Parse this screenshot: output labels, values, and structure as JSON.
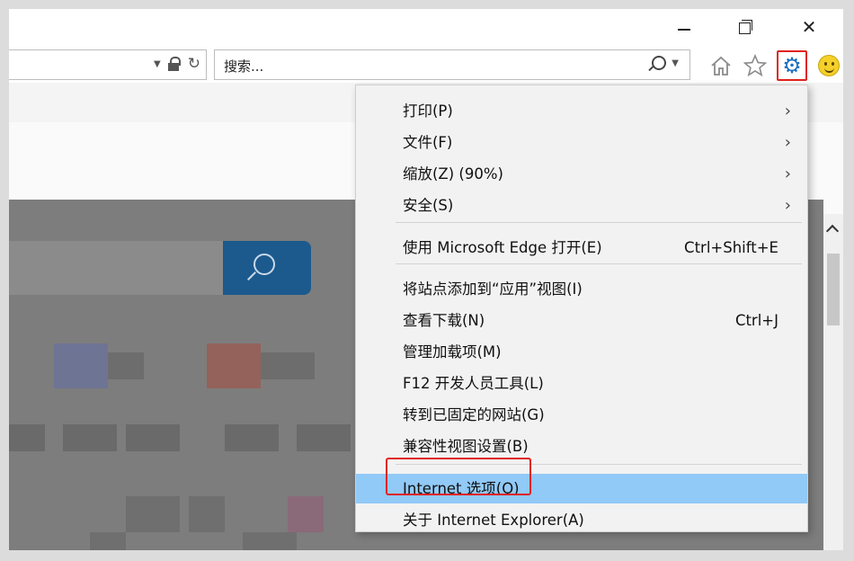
{
  "search": {
    "placeholder": "搜索..."
  },
  "menu": {
    "items": [
      {
        "label": "打印(P)",
        "shortcut": "",
        "submenu": true
      },
      {
        "label": "文件(F)",
        "shortcut": "",
        "submenu": true
      },
      {
        "label": "缩放(Z) (90%)",
        "shortcut": "",
        "submenu": true
      },
      {
        "label": "安全(S)",
        "shortcut": "",
        "submenu": true
      },
      {
        "label": "使用 Microsoft Edge 打开(E)",
        "shortcut": "Ctrl+Shift+E",
        "submenu": false
      },
      {
        "label": "将站点添加到“应用”视图(I)",
        "shortcut": "",
        "submenu": false
      },
      {
        "label": "查看下载(N)",
        "shortcut": "Ctrl+J",
        "submenu": false
      },
      {
        "label": "管理加载项(M)",
        "shortcut": "",
        "submenu": false
      },
      {
        "label": "F12 开发人员工具(L)",
        "shortcut": "",
        "submenu": false
      },
      {
        "label": "转到已固定的网站(G)",
        "shortcut": "",
        "submenu": false
      },
      {
        "label": "兼容性视图设置(B)",
        "shortcut": "",
        "submenu": false
      },
      {
        "label": "Internet 选项(O)",
        "shortcut": "",
        "submenu": false,
        "highlighted": true
      },
      {
        "label": "关于 Internet Explorer(A)",
        "shortcut": "",
        "submenu": false
      }
    ]
  },
  "icons": {
    "home": "home-icon",
    "favorites": "star-icon",
    "tools": "gear-icon",
    "feedback": "smiley-icon"
  },
  "colors": {
    "highlight": "#91c9f7",
    "annotation": "#e0231c",
    "gear": "#1f6fbf"
  }
}
